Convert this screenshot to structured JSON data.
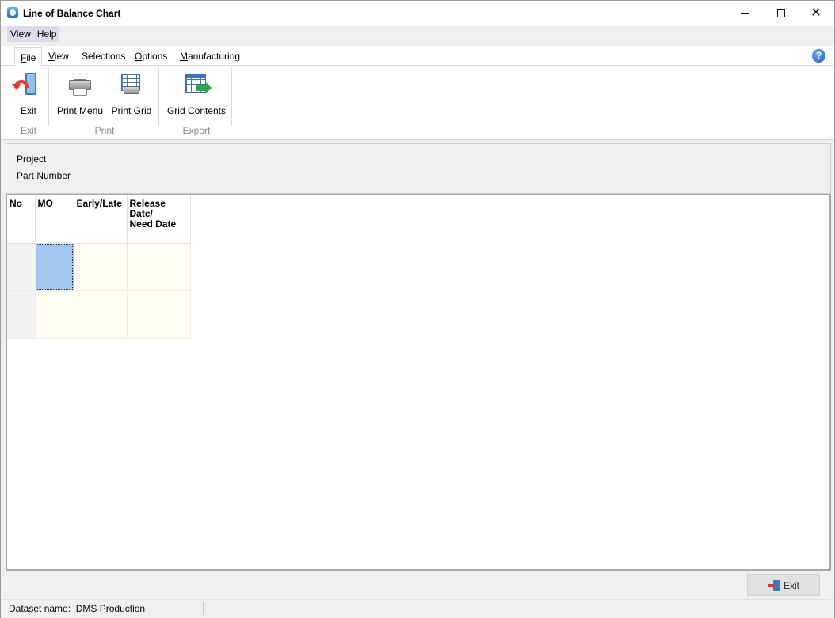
{
  "window": {
    "title": "Line of Balance Chart",
    "minimize_glyph": "",
    "close_glyph": "✕"
  },
  "menubar": {
    "items": [
      "View",
      "Help"
    ]
  },
  "ribbon_tabs": [
    {
      "label_prefix": "",
      "label_mnemonic": "F",
      "label_rest": "ile",
      "active": true
    },
    {
      "label_prefix": "",
      "label_mnemonic": "V",
      "label_rest": "iew",
      "active": false
    },
    {
      "label_prefix": "",
      "label_mnemonic": "",
      "label_rest": "Selections",
      "active": false
    },
    {
      "label_prefix": "",
      "label_mnemonic": "O",
      "label_rest": "ptions",
      "active": false
    },
    {
      "label_prefix": "",
      "label_mnemonic": "M",
      "label_rest": "anufacturing",
      "active": false
    }
  ],
  "help_icon_glyph": "?",
  "ribbon": {
    "exit_button": "Exit",
    "print_menu_button": "Print Menu",
    "print_grid_button": "Print Grid",
    "grid_contents_button": "Grid Contents",
    "groups": {
      "exit": "Exit",
      "print": "Print",
      "export": "Export"
    }
  },
  "info": {
    "project_label": "Project",
    "part_number_label": "Part Number"
  },
  "grid": {
    "columns": {
      "no": "No",
      "mo": "MO",
      "early_late": "Early/Late",
      "release_line1": "Release",
      "release_line2": "Date/",
      "release_line3": "Need Date"
    },
    "row_count": 2,
    "selected_cell": {
      "row": 1,
      "column": "MO"
    }
  },
  "footer": {
    "exit_button_mnemonic": "E",
    "exit_button_rest": "xit",
    "dataset_label": "Dataset name:",
    "dataset_value": "DMS Production"
  },
  "colors": {
    "selected_cell": "#a3c8ef",
    "cell_background": "#fffcf2",
    "menubar_background": "#dcdce8"
  }
}
